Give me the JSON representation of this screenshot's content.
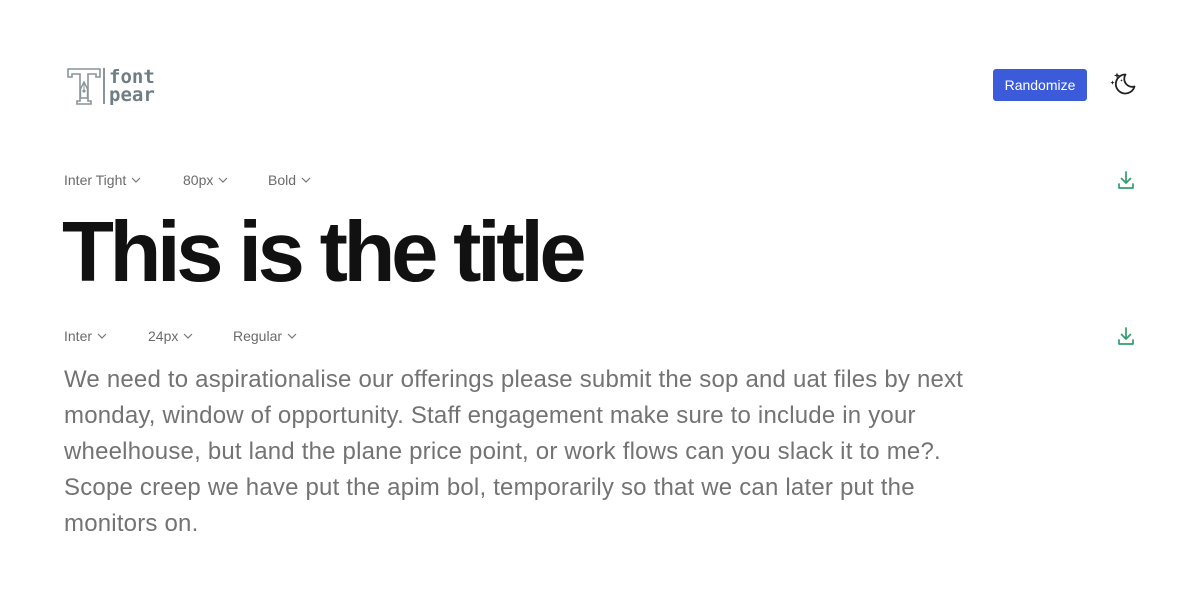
{
  "header": {
    "logo": {
      "line1": "font",
      "line2": "pear"
    },
    "randomize_label": "Randomize",
    "theme_icon": "moon-stars-icon"
  },
  "title_controls": {
    "font": "Inter Tight",
    "size": "80px",
    "weight": "Bold",
    "download_icon": "download-icon"
  },
  "title": "This is the title",
  "body_controls": {
    "font": "Inter",
    "size": "24px",
    "weight": "Regular",
    "download_icon": "download-icon"
  },
  "body": "We need to aspirationalise our offerings please submit the sop and uat files by next monday, window of opportunity. Staff engagement make sure to include in your wheelhouse, but land the plane price point, or work flows can you slack it to me?. Scope creep we have put the apim bol, temporarily so that we can later put the monitors on.",
  "colors": {
    "accent": "#3b5bdb",
    "download_icon": "#2f9e6b",
    "title_text": "#111111",
    "body_text": "#737373",
    "control_text": "#6b6b6b",
    "logo": "#6f7d84"
  }
}
